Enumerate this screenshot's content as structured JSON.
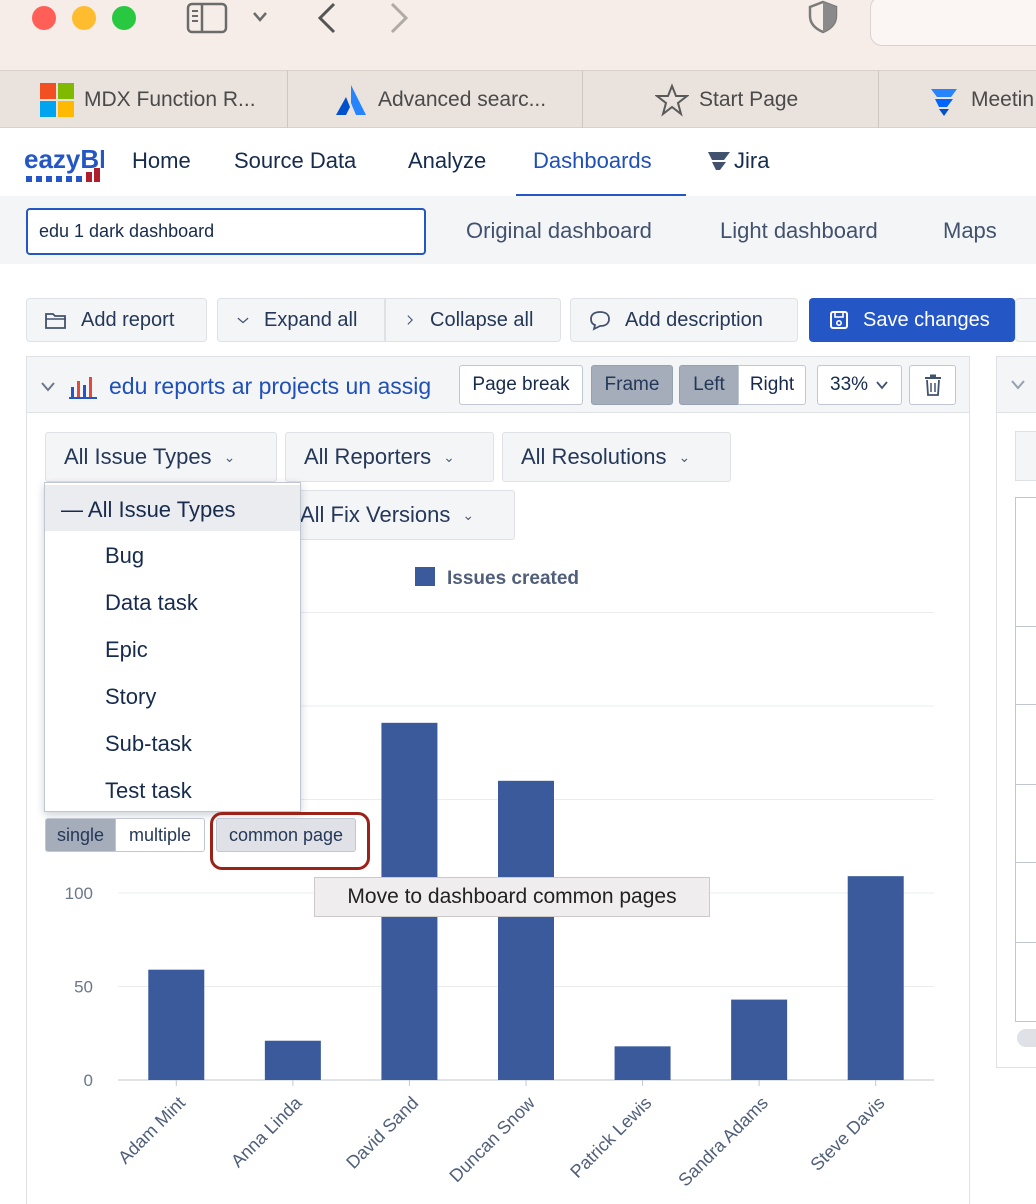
{
  "browser": {
    "tabs": [
      {
        "label": "MDX Function R..."
      },
      {
        "label": "Advanced searc..."
      },
      {
        "label": "Start Page"
      },
      {
        "label": "Meetin"
      }
    ]
  },
  "app": {
    "logo_text": "eazyBI",
    "nav": [
      {
        "label": "Home"
      },
      {
        "label": "Source Data"
      },
      {
        "label": "Analyze"
      },
      {
        "label": "Dashboards"
      },
      {
        "label": "Jira"
      }
    ],
    "active_nav": "Dashboards"
  },
  "dashboard": {
    "name_value": "edu 1 dark dashboard",
    "tabs": [
      {
        "label": "Original dashboard"
      },
      {
        "label": "Light dashboard"
      },
      {
        "label": "Maps"
      }
    ]
  },
  "toolbar": {
    "add_report": "Add report",
    "expand_all": "Expand all",
    "collapse_all": "Collapse all",
    "add_description": "Add description",
    "save_changes": "Save changes"
  },
  "report": {
    "title": "edu reports ar projects un assig",
    "page_break": "Page break",
    "frame": "Frame",
    "left": "Left",
    "right": "Right",
    "width": "33%",
    "filters": [
      {
        "label": "All Issue Types"
      },
      {
        "label": "All Reporters"
      },
      {
        "label": "All Resolutions"
      },
      {
        "label": "All Fix Versions"
      }
    ]
  },
  "dropdown": {
    "header": "— All Issue Types",
    "items": [
      "Bug",
      "Data task",
      "Epic",
      "Story",
      "Sub-task",
      "Test task"
    ],
    "single": "single",
    "multiple": "multiple",
    "common_page": "common page",
    "tooltip": "Move to dashboard common pages"
  },
  "colors": {
    "accent": "#2457c5",
    "bar": "#3a5a9c",
    "highlight": "#9b2218"
  },
  "chart_data": {
    "type": "bar",
    "legend": [
      "Issues created"
    ],
    "categories": [
      "Adam Mint",
      "Anna Linda",
      "David Sand",
      "Duncan Snow",
      "Patrick Lewis",
      "Sandra Adams",
      "Steve Davis"
    ],
    "series": [
      {
        "name": "Issues created",
        "values": [
          59,
          21,
          191,
          160,
          18,
          43,
          109
        ]
      }
    ],
    "y_ticks": [
      0,
      50,
      100
    ],
    "ylim": [
      0,
      250
    ],
    "grid": true,
    "legend_position": "top"
  }
}
